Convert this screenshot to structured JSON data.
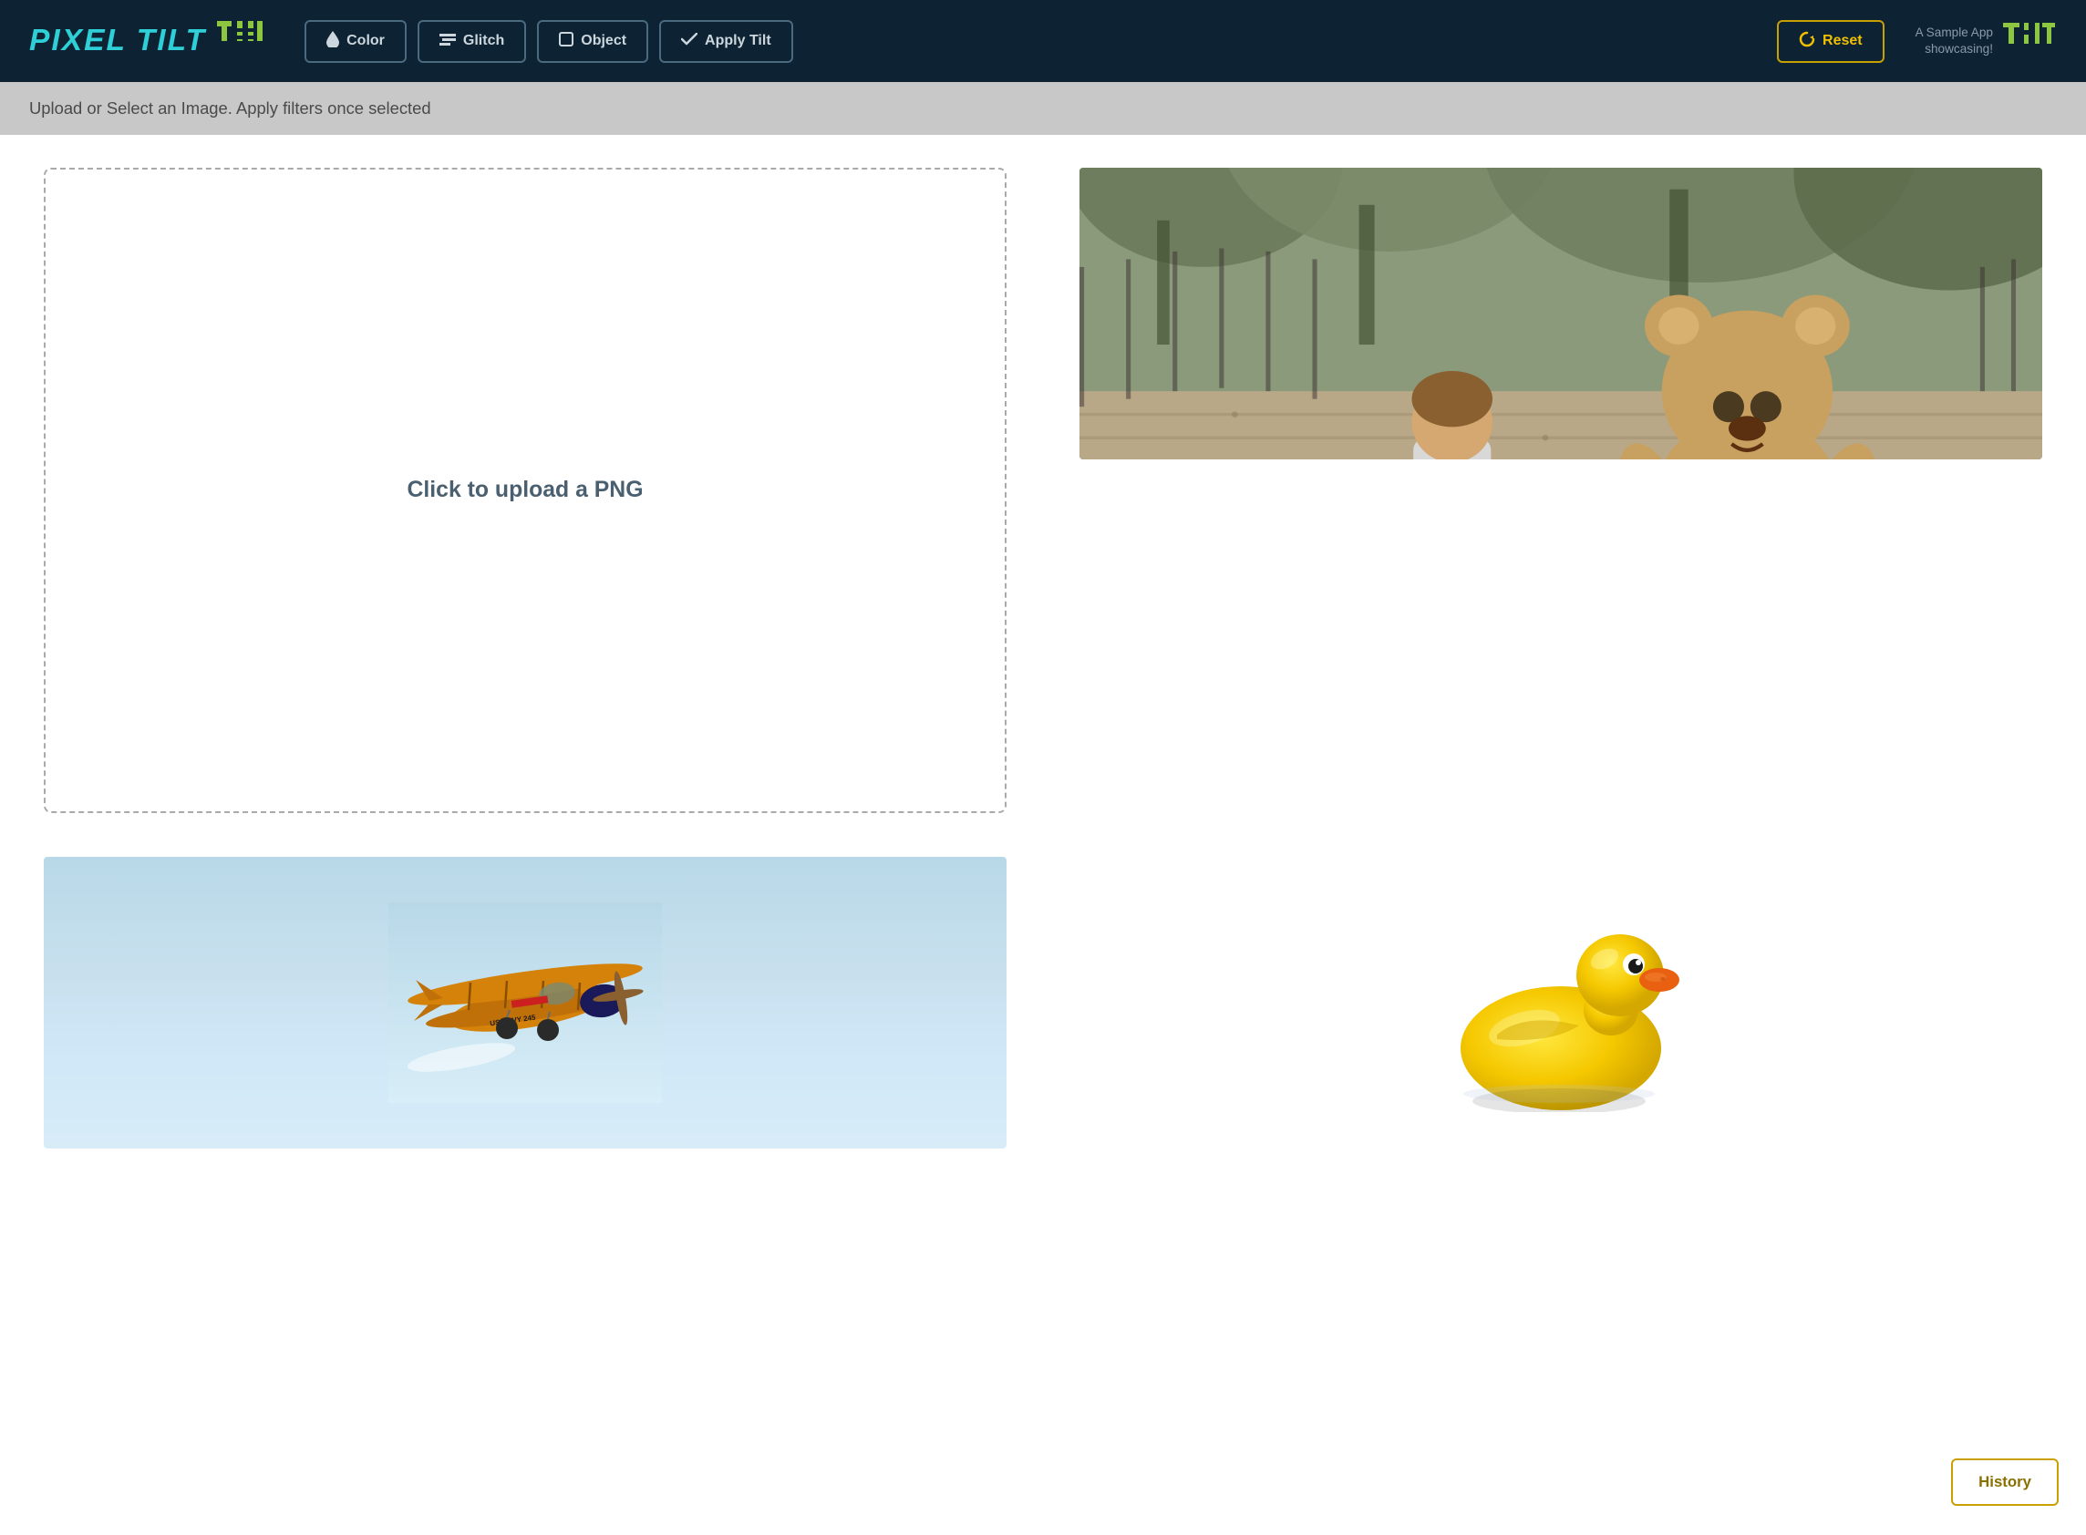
{
  "header": {
    "logo_text": "PiXEL TiLT",
    "buttons": [
      {
        "id": "color",
        "label": "Color",
        "icon": "drop-icon"
      },
      {
        "id": "glitch",
        "label": "Glitch",
        "icon": "glitch-icon"
      },
      {
        "id": "object",
        "label": "Object",
        "icon": "object-icon"
      },
      {
        "id": "apply_tilt",
        "label": "Apply Tilt",
        "icon": "check-icon"
      }
    ],
    "reset_label": "Reset",
    "sample_line1": "A Sample App",
    "sample_line2": "showcasing!"
  },
  "banner": {
    "text": "Upload or Select an Image. Apply filters once selected"
  },
  "upload": {
    "label": "Click to upload a PNG"
  },
  "images": [
    {
      "id": "child-bear",
      "alt": "Child and teddy bear on wooden deck"
    },
    {
      "id": "plane",
      "alt": "US Navy biplane"
    },
    {
      "id": "duck",
      "alt": "Yellow rubber duck"
    }
  ],
  "history_button": {
    "label": "History"
  },
  "colors": {
    "header_bg": "#0d2233",
    "logo_cyan": "#2ecfd6",
    "logo_green": "#8dc63f",
    "banner_bg": "#c8c8c8",
    "border_gold": "#c8a000",
    "text_gold": "#f0c000",
    "upload_text": "#4a6070"
  }
}
